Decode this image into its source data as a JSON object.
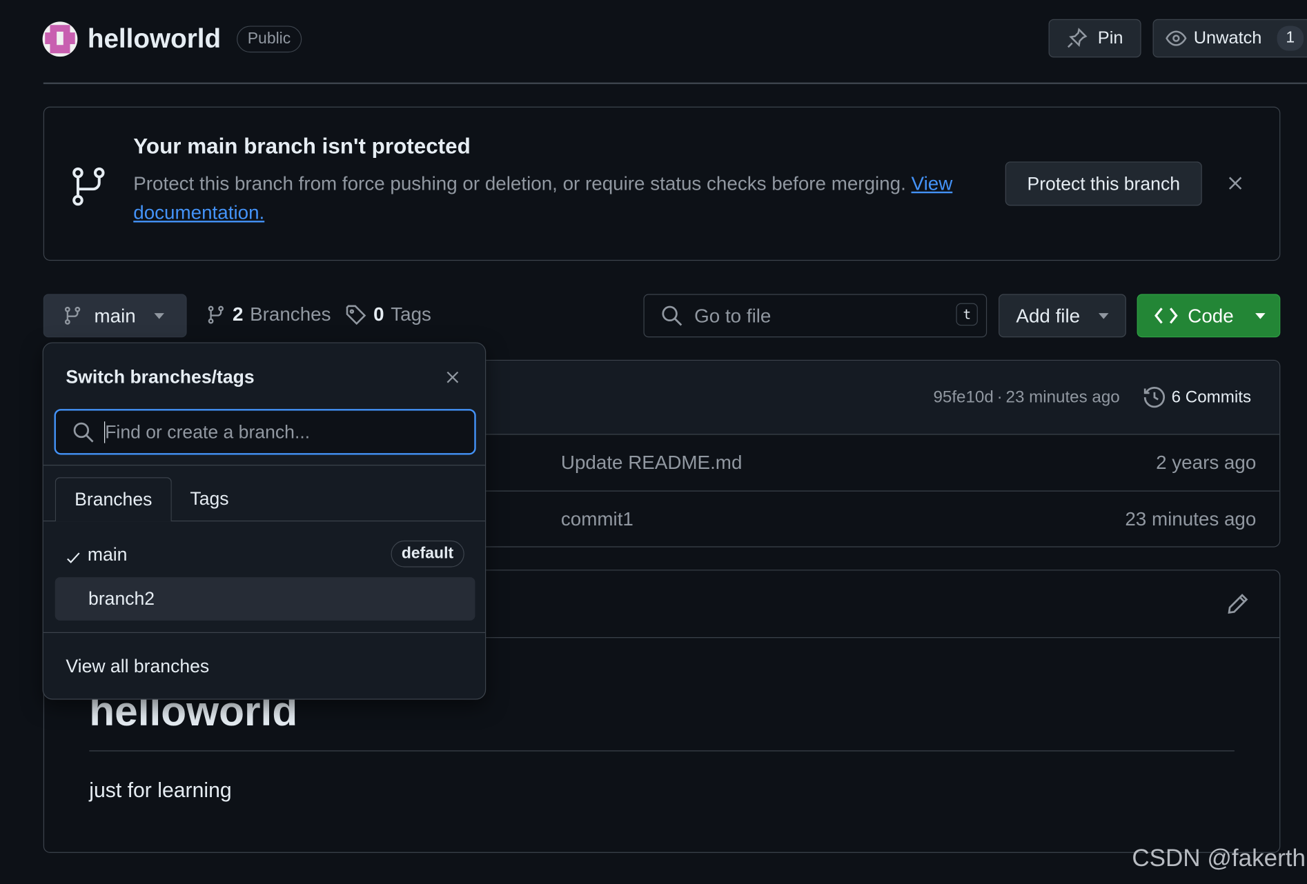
{
  "repo": {
    "name": "helloworld",
    "visibility": "Public",
    "pin_label": "Pin",
    "unwatch_label": "Unwatch",
    "watch_count": "1"
  },
  "banner": {
    "title": "Your main branch isn't protected",
    "text": "Protect this branch from force pushing or deletion, or require status checks before merging.",
    "link": "View documentation.",
    "button": "Protect this branch"
  },
  "toolbar": {
    "branch": "main",
    "branches_count": "2",
    "branches_label": "Branches",
    "tags_count": "0",
    "tags_label": "Tags",
    "goto_placeholder": "Go to file",
    "goto_shortcut": "t",
    "add_file": "Add file",
    "code": "Code"
  },
  "commit_header": {
    "hash": "95fe10d",
    "sep": "·",
    "time": "23 minutes ago",
    "commits": "6 Commits"
  },
  "files": [
    {
      "message": "Update README.md",
      "time": "2 years ago"
    },
    {
      "message": "commit1",
      "time": "23 minutes ago"
    }
  ],
  "readme": {
    "heading": "helloworld",
    "body": "just for learning"
  },
  "dropdown": {
    "title": "Switch branches/tags",
    "placeholder": "Find or create a branch...",
    "tabs": [
      "Branches",
      "Tags"
    ],
    "branches": [
      {
        "name": "main",
        "badge": "default",
        "selected": true
      },
      {
        "name": "branch2"
      }
    ],
    "view_all": "View all branches"
  },
  "watermark": "CSDN @fakerth",
  "colors": {
    "accent": "#4493f8",
    "green": "#238636",
    "bg": "#0d1117"
  }
}
